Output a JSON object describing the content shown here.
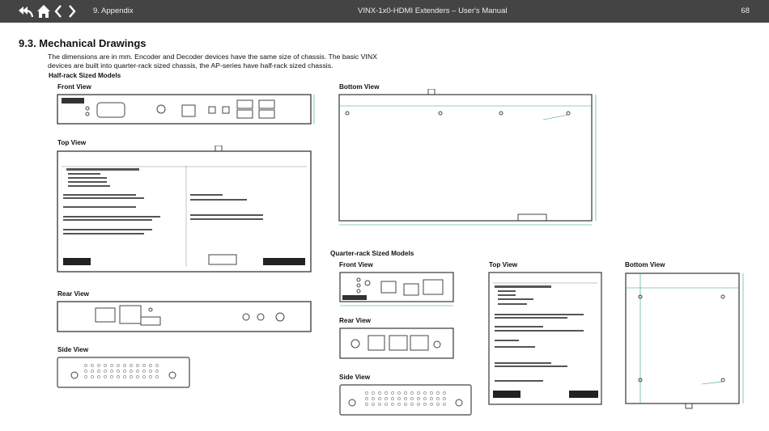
{
  "header": {
    "section": "9. Appendix",
    "title": "VINX-1x0-HDMI Extenders – User's Manual",
    "page": "68"
  },
  "heading": "9.3. Mechanical Drawings",
  "intro": "The dimensions are in mm. Encoder and Decoder devices have the same size of chassis. The basic VINX devices are built into quarter-rack sized chassis, the AP-series have half-rack sized chassis.",
  "half_rack": {
    "title": "Half-rack Sized Models",
    "front_view": "Front View",
    "top_view": "Top View",
    "rear_view": "Rear View",
    "side_view": "Side View",
    "bottom_view": "Bottom View"
  },
  "quarter_rack": {
    "title": "Quarter-rack Sized Models",
    "front_view": "Front View",
    "top_view": "Top View",
    "rear_view": "Rear View",
    "side_view": "Side View",
    "bottom_view": "Bottom View"
  },
  "colors": {
    "topbar": "#444444",
    "line": "#444444",
    "dim": "#2a9d8f"
  }
}
